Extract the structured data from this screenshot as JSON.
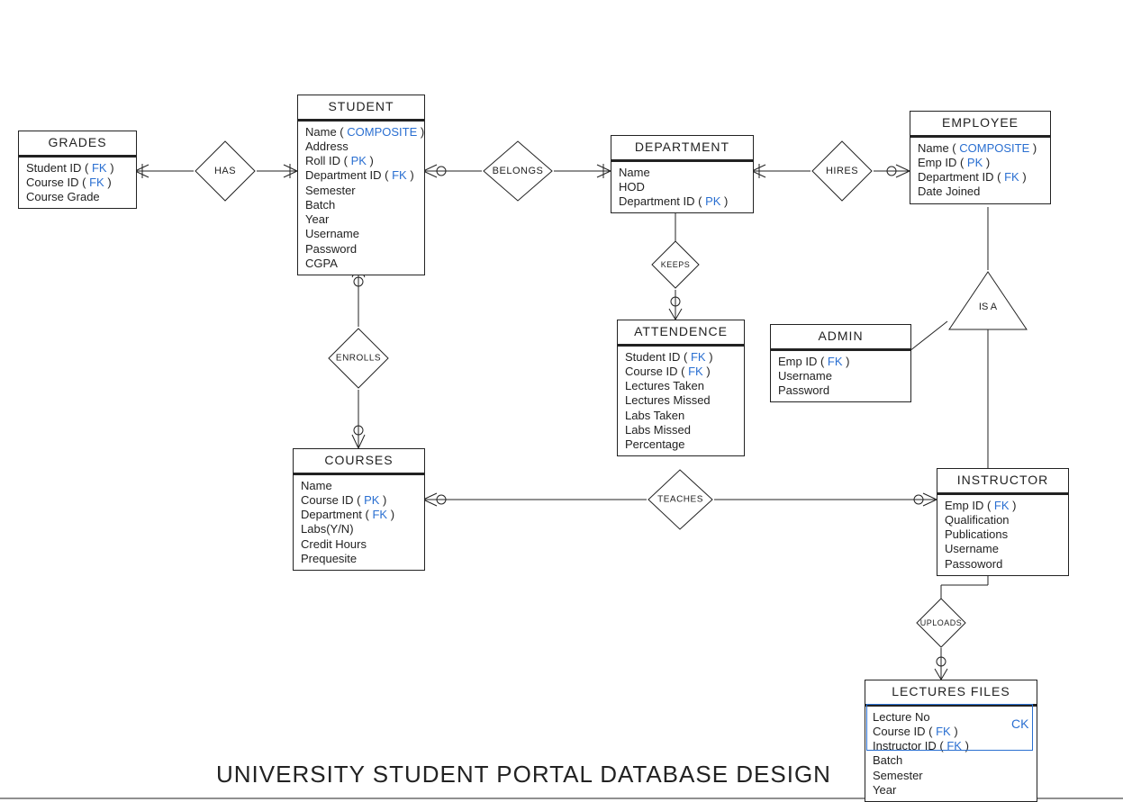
{
  "page_title": "UNIVERSITY STUDENT PORTAL DATABASE DESIGN",
  "entities": {
    "grades": {
      "title": "GRADES",
      "attrs": [
        {
          "text": "Student ID",
          "key": "FK"
        },
        {
          "text": "Course ID",
          "key": "FK"
        },
        {
          "text": "Course Grade"
        }
      ]
    },
    "student": {
      "title": "STUDENT",
      "attrs": [
        {
          "text": "Name",
          "key": "COMPOSITE"
        },
        {
          "text": "Address"
        },
        {
          "text": "Roll ID",
          "key": "PK"
        },
        {
          "text": "Department ID",
          "key": "FK"
        },
        {
          "text": "Semester"
        },
        {
          "text": "Batch"
        },
        {
          "text": "Year"
        },
        {
          "text": "Username"
        },
        {
          "text": "Password"
        },
        {
          "text": "CGPA"
        }
      ]
    },
    "department": {
      "title": "DEPARTMENT",
      "attrs": [
        {
          "text": "Name"
        },
        {
          "text": "HOD"
        },
        {
          "text": "Department ID",
          "key": "PK"
        }
      ]
    },
    "employee": {
      "title": "EMPLOYEE",
      "attrs": [
        {
          "text": "Name",
          "key": "COMPOSITE"
        },
        {
          "text": "Emp ID",
          "key": "PK"
        },
        {
          "text": "Department ID",
          "key": "FK"
        },
        {
          "text": "Date Joined"
        }
      ]
    },
    "attendence": {
      "title": "ATTENDENCE",
      "attrs": [
        {
          "text": "Student ID",
          "key": "FK"
        },
        {
          "text": "Course ID",
          "key": "FK"
        },
        {
          "text": "Lectures Taken"
        },
        {
          "text": "Lectures Missed"
        },
        {
          "text": "Labs Taken"
        },
        {
          "text": "Labs Missed"
        },
        {
          "text": "Percentage"
        }
      ]
    },
    "admin": {
      "title": "ADMIN",
      "attrs": [
        {
          "text": "Emp ID",
          "key": "FK"
        },
        {
          "text": "Username"
        },
        {
          "text": "Password"
        }
      ]
    },
    "courses": {
      "title": "COURSES",
      "attrs": [
        {
          "text": "Name"
        },
        {
          "text": "Course ID",
          "key": "PK"
        },
        {
          "text": "Department",
          "key": "FK"
        },
        {
          "text": "Labs(Y/N)"
        },
        {
          "text": "Credit Hours"
        },
        {
          "text": "Prequesite"
        }
      ]
    },
    "instructor": {
      "title": "INSTRUCTOR",
      "attrs": [
        {
          "text": "Emp ID",
          "key": "FK"
        },
        {
          "text": "Qualification"
        },
        {
          "text": "Publications"
        },
        {
          "text": "Username"
        },
        {
          "text": "Passoword"
        }
      ]
    },
    "lectures_files": {
      "title": "LECTURES FILES",
      "attrs": [
        {
          "text": "Lecture No"
        },
        {
          "text": "Course ID",
          "key": "FK"
        },
        {
          "text": "Instructor ID",
          "key": "FK"
        },
        {
          "text": "Batch"
        },
        {
          "text": "Semester"
        },
        {
          "text": "Year"
        }
      ]
    }
  },
  "relationships": {
    "has": "HAS",
    "belongs": "BELONGS",
    "hires": "HIRES",
    "keeps": "KEEPS",
    "enrolls": "ENROLLS",
    "teaches": "TEACHES",
    "uploads": "UPLOADS",
    "isa": "IS A"
  },
  "ck_label": "CK"
}
